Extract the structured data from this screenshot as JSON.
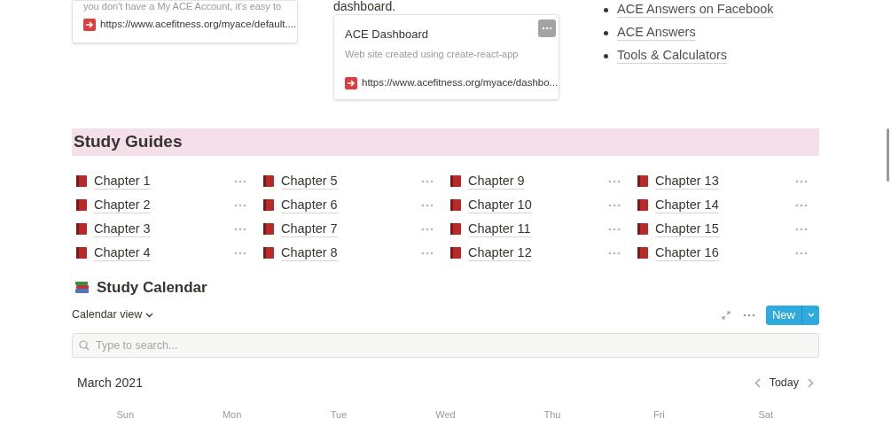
{
  "bookmarks": [
    {
      "description": "you don't have a My ACE Account, it's easy to",
      "url": "https://www.acefitness.org/myace/default...."
    },
    {
      "intro": "dashboard.",
      "title": "ACE Dashboard",
      "description": "Web site created using create-react-app",
      "url": "https://www.acefitness.org/myace/dashbo..."
    }
  ],
  "links": [
    "ACE Answers on Facebook",
    "ACE Answers",
    "Tools & Calculators"
  ],
  "study_guides": {
    "title": "Study Guides",
    "pages": [
      "Chapter 1",
      "Chapter 2",
      "Chapter 3",
      "Chapter 4",
      "Chapter 5",
      "Chapter 6",
      "Chapter 7",
      "Chapter 8",
      "Chapter 9",
      "Chapter 10",
      "Chapter 11",
      "Chapter 12",
      "Chapter 13",
      "Chapter 14",
      "Chapter 15",
      "Chapter 16"
    ]
  },
  "calendar": {
    "title": "Study Calendar",
    "view": "Calendar view",
    "new_button": "New",
    "search": {
      "placeholder": "Type to search..."
    },
    "month": "March 2021",
    "today": "Today",
    "weekdays": [
      "Sun",
      "Mon",
      "Tue",
      "Wed",
      "Thu",
      "Fri",
      "Sat"
    ]
  }
}
